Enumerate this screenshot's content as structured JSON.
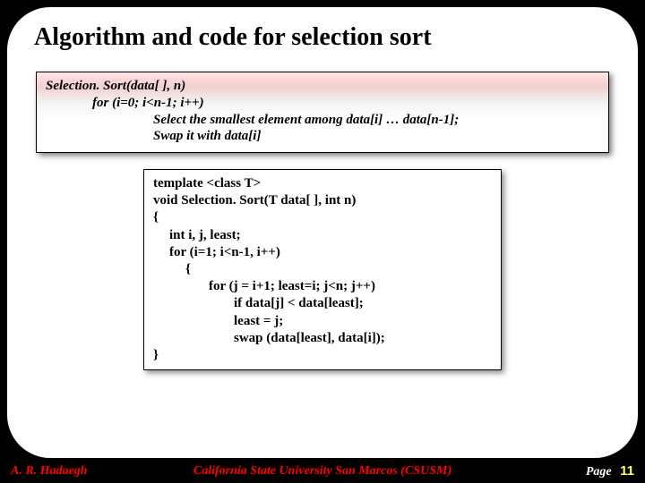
{
  "title": "Algorithm and code for selection sort",
  "pseudo": {
    "sig": "Selection. Sort(data[ ], n)",
    "for": "for (i=0; i<n-1; i++)",
    "select": "Select the smallest element among data[i] … data[n-1];",
    "swap": "Swap it with data[i]"
  },
  "code": {
    "l0": "template <class T>",
    "l1": "void Selection. Sort(T data[ ], int n)",
    "l2": "{",
    "l3": "int i, j, least;",
    "l4": "for (i=1; i<n-1, i++)",
    "l5": "{",
    "l6": "for (j = i+1; least=i; j<n; j++)",
    "l7": "if data[j] < data[least];",
    "l8": "least = j;",
    "l9": "swap (data[least], data[i]);",
    "l10": "}"
  },
  "footer": {
    "author": "A. R. Hadaegh",
    "affiliation": "California State University San Marcos (CSUSM)",
    "page_label": "Page",
    "page_num": "11"
  }
}
